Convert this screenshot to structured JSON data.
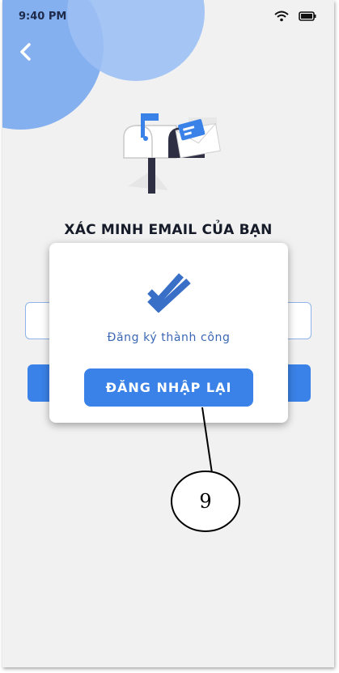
{
  "status_bar": {
    "time": "9:40 PM"
  },
  "page": {
    "title": "XÁC MINH EMAIL CỦA BẠN"
  },
  "modal": {
    "message": "Đăng ký thành công",
    "button_label": "ĐĂNG NHẬP LẠI"
  },
  "annotation": {
    "number": "9"
  },
  "icons": {
    "back": "chevron-left-icon",
    "wifi": "wifi-icon",
    "battery": "battery-icon",
    "mailbox": "mailbox-illustration",
    "success": "double-check-icon"
  },
  "colors": {
    "accent": "#3a82e8",
    "blob": "#79a9ee",
    "message": "#3b67b4",
    "title": "#161b29",
    "background": "#f1f1f1"
  }
}
